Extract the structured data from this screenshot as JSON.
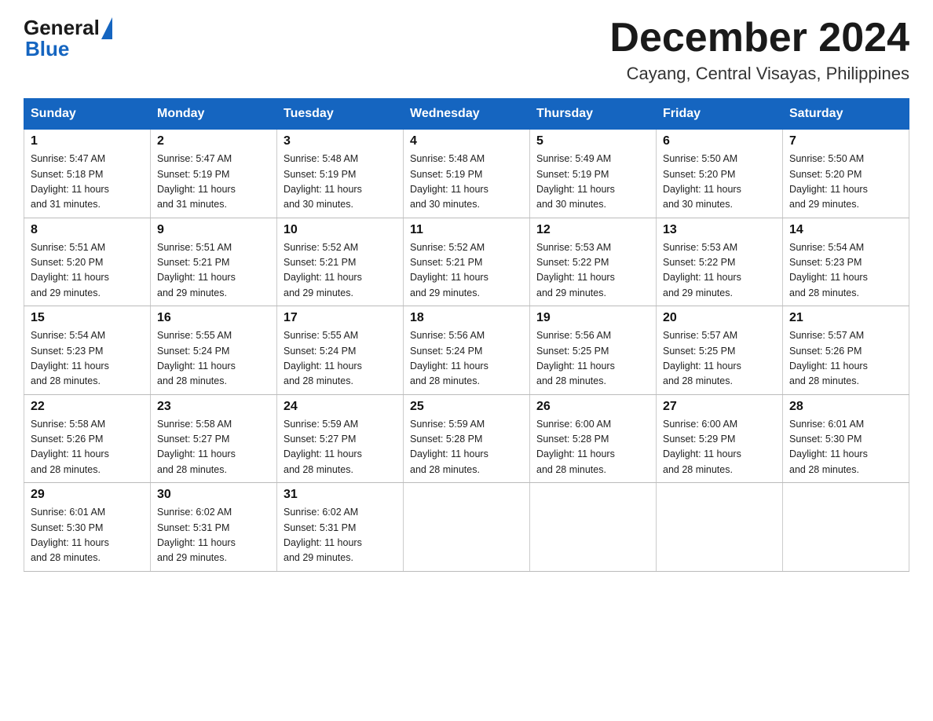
{
  "header": {
    "logo_general": "General",
    "logo_blue": "Blue",
    "month_title": "December 2024",
    "location": "Cayang, Central Visayas, Philippines"
  },
  "weekdays": [
    "Sunday",
    "Monday",
    "Tuesday",
    "Wednesday",
    "Thursday",
    "Friday",
    "Saturday"
  ],
  "weeks": [
    [
      {
        "day": "1",
        "sunrise": "5:47 AM",
        "sunset": "5:18 PM",
        "daylight": "11 hours and 31 minutes."
      },
      {
        "day": "2",
        "sunrise": "5:47 AM",
        "sunset": "5:19 PM",
        "daylight": "11 hours and 31 minutes."
      },
      {
        "day": "3",
        "sunrise": "5:48 AM",
        "sunset": "5:19 PM",
        "daylight": "11 hours and 30 minutes."
      },
      {
        "day": "4",
        "sunrise": "5:48 AM",
        "sunset": "5:19 PM",
        "daylight": "11 hours and 30 minutes."
      },
      {
        "day": "5",
        "sunrise": "5:49 AM",
        "sunset": "5:19 PM",
        "daylight": "11 hours and 30 minutes."
      },
      {
        "day": "6",
        "sunrise": "5:50 AM",
        "sunset": "5:20 PM",
        "daylight": "11 hours and 30 minutes."
      },
      {
        "day": "7",
        "sunrise": "5:50 AM",
        "sunset": "5:20 PM",
        "daylight": "11 hours and 29 minutes."
      }
    ],
    [
      {
        "day": "8",
        "sunrise": "5:51 AM",
        "sunset": "5:20 PM",
        "daylight": "11 hours and 29 minutes."
      },
      {
        "day": "9",
        "sunrise": "5:51 AM",
        "sunset": "5:21 PM",
        "daylight": "11 hours and 29 minutes."
      },
      {
        "day": "10",
        "sunrise": "5:52 AM",
        "sunset": "5:21 PM",
        "daylight": "11 hours and 29 minutes."
      },
      {
        "day": "11",
        "sunrise": "5:52 AM",
        "sunset": "5:21 PM",
        "daylight": "11 hours and 29 minutes."
      },
      {
        "day": "12",
        "sunrise": "5:53 AM",
        "sunset": "5:22 PM",
        "daylight": "11 hours and 29 minutes."
      },
      {
        "day": "13",
        "sunrise": "5:53 AM",
        "sunset": "5:22 PM",
        "daylight": "11 hours and 29 minutes."
      },
      {
        "day": "14",
        "sunrise": "5:54 AM",
        "sunset": "5:23 PM",
        "daylight": "11 hours and 28 minutes."
      }
    ],
    [
      {
        "day": "15",
        "sunrise": "5:54 AM",
        "sunset": "5:23 PM",
        "daylight": "11 hours and 28 minutes."
      },
      {
        "day": "16",
        "sunrise": "5:55 AM",
        "sunset": "5:24 PM",
        "daylight": "11 hours and 28 minutes."
      },
      {
        "day": "17",
        "sunrise": "5:55 AM",
        "sunset": "5:24 PM",
        "daylight": "11 hours and 28 minutes."
      },
      {
        "day": "18",
        "sunrise": "5:56 AM",
        "sunset": "5:24 PM",
        "daylight": "11 hours and 28 minutes."
      },
      {
        "day": "19",
        "sunrise": "5:56 AM",
        "sunset": "5:25 PM",
        "daylight": "11 hours and 28 minutes."
      },
      {
        "day": "20",
        "sunrise": "5:57 AM",
        "sunset": "5:25 PM",
        "daylight": "11 hours and 28 minutes."
      },
      {
        "day": "21",
        "sunrise": "5:57 AM",
        "sunset": "5:26 PM",
        "daylight": "11 hours and 28 minutes."
      }
    ],
    [
      {
        "day": "22",
        "sunrise": "5:58 AM",
        "sunset": "5:26 PM",
        "daylight": "11 hours and 28 minutes."
      },
      {
        "day": "23",
        "sunrise": "5:58 AM",
        "sunset": "5:27 PM",
        "daylight": "11 hours and 28 minutes."
      },
      {
        "day": "24",
        "sunrise": "5:59 AM",
        "sunset": "5:27 PM",
        "daylight": "11 hours and 28 minutes."
      },
      {
        "day": "25",
        "sunrise": "5:59 AM",
        "sunset": "5:28 PM",
        "daylight": "11 hours and 28 minutes."
      },
      {
        "day": "26",
        "sunrise": "6:00 AM",
        "sunset": "5:28 PM",
        "daylight": "11 hours and 28 minutes."
      },
      {
        "day": "27",
        "sunrise": "6:00 AM",
        "sunset": "5:29 PM",
        "daylight": "11 hours and 28 minutes."
      },
      {
        "day": "28",
        "sunrise": "6:01 AM",
        "sunset": "5:30 PM",
        "daylight": "11 hours and 28 minutes."
      }
    ],
    [
      {
        "day": "29",
        "sunrise": "6:01 AM",
        "sunset": "5:30 PM",
        "daylight": "11 hours and 28 minutes."
      },
      {
        "day": "30",
        "sunrise": "6:02 AM",
        "sunset": "5:31 PM",
        "daylight": "11 hours and 29 minutes."
      },
      {
        "day": "31",
        "sunrise": "6:02 AM",
        "sunset": "5:31 PM",
        "daylight": "11 hours and 29 minutes."
      },
      null,
      null,
      null,
      null
    ]
  ],
  "labels": {
    "sunrise_prefix": "Sunrise: ",
    "sunset_prefix": "Sunset: ",
    "daylight_prefix": "Daylight: "
  }
}
